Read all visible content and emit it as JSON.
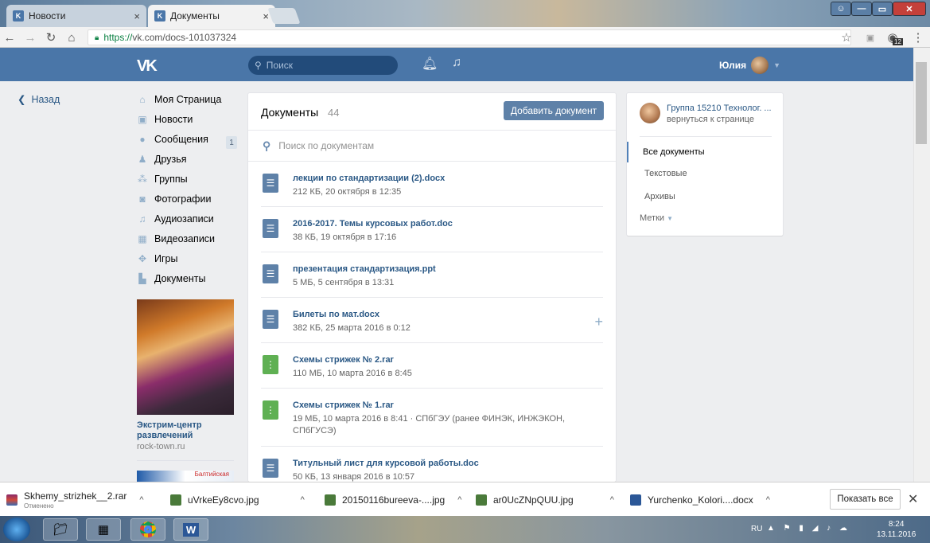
{
  "browser": {
    "tabs": [
      {
        "label": "Новости",
        "favicon": "vk-favicon"
      },
      {
        "label": "Документы",
        "favicon": "vk-favicon"
      }
    ],
    "url_https": "https://",
    "url_rest": "vk.com/docs-101037324",
    "extension_badge": "12"
  },
  "vk_header": {
    "logo": "VK",
    "search_placeholder": "Поиск",
    "user_name": "Юлия"
  },
  "left_nav": {
    "back_label": "Назад",
    "items": [
      {
        "label": "Моя Страница",
        "icon": "home-icon"
      },
      {
        "label": "Новости",
        "icon": "news-icon"
      },
      {
        "label": "Сообщения",
        "icon": "messages-icon",
        "count": "1"
      },
      {
        "label": "Друзья",
        "icon": "friends-icon"
      },
      {
        "label": "Группы",
        "icon": "groups-icon"
      },
      {
        "label": "Фотографии",
        "icon": "camera-icon"
      },
      {
        "label": "Аудиозаписи",
        "icon": "music-icon"
      },
      {
        "label": "Видеозаписи",
        "icon": "video-icon"
      },
      {
        "label": "Игры",
        "icon": "gamepad-icon"
      },
      {
        "label": "Документы",
        "icon": "document-icon"
      }
    ],
    "ad": {
      "title": "Экстрим-центр развлечений",
      "site": "rock-town.ru",
      "ad2_text": "Балтийская"
    }
  },
  "documents": {
    "title": "Документы",
    "count": "44",
    "add_button": "Добавить документ",
    "search_placeholder": "Поиск по документам",
    "items": [
      {
        "name": "лекции по стандартизации (2).docx",
        "meta": "212 КБ, 20 октября в 12:35",
        "type": "text"
      },
      {
        "name": "2016-2017. Темы курсовых работ.doc",
        "meta": "38 КБ, 19 октября в 17:16",
        "type": "text"
      },
      {
        "name": "презентация стандартизация.ppt",
        "meta": "5 МБ, 5 сентября в 13:31",
        "type": "text"
      },
      {
        "name": "Билеты по мат.docx",
        "meta": "382 КБ, 25 марта 2016 в 0:12",
        "type": "text"
      },
      {
        "name": "Схемы стрижек № 2.rar",
        "meta": "110 МБ, 10 марта 2016 в 8:45",
        "type": "archive"
      },
      {
        "name": "Схемы стрижек № 1.rar",
        "meta": "19 МБ, 10 марта 2016 в 8:41 · СПбГЭУ (ранее ФИНЭК, ИНЖЭКОН, СПбГУСЭ)",
        "type": "archive"
      },
      {
        "name": "Титульный лист для курсовой работы.doc",
        "meta": "50 КБ, 13 января 2016 в 10:57",
        "type": "text"
      }
    ]
  },
  "sidebar": {
    "group_name": "Группа 15210 Технолог. ...",
    "group_back": "вернуться к странице",
    "filters": [
      "Все документы",
      "Текстовые",
      "Архивы"
    ],
    "tags_label": "Метки"
  },
  "downloads": {
    "items": [
      {
        "name": "Skhemy_strizhek__2.rar",
        "status": "Отменено"
      },
      {
        "name": "uVrkeEy8cvo.jpg",
        "status": ""
      },
      {
        "name": "20150116bureeva-....jpg",
        "status": ""
      },
      {
        "name": "ar0UcZNpQUU.jpg",
        "status": ""
      },
      {
        "name": "Yurchenko_Kolori....docx",
        "status": ""
      }
    ],
    "show_all": "Показать все"
  },
  "taskbar": {
    "lang": "RU",
    "time": "8:24",
    "date": "13.11.2016"
  },
  "colors": {
    "vk_blue": "#4a76a8",
    "link": "#2a5885",
    "doc_text_icon": "#5e81a8",
    "doc_archive_icon": "#5fb053"
  }
}
